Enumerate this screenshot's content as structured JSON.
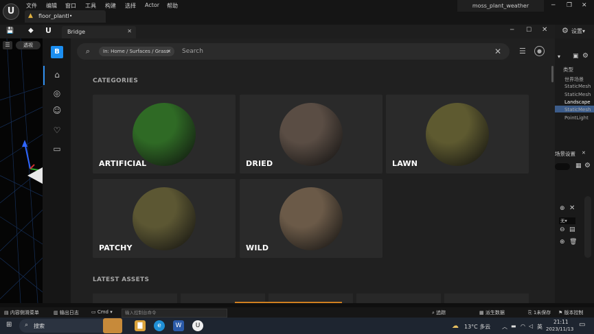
{
  "menu": [
    "文件",
    "编辑",
    "窗口",
    "工具",
    "构建",
    "选择",
    "Actor",
    "帮助"
  ],
  "level_tab": "floor_plantl•",
  "project_name": "moss_plant_weather",
  "settings_label": "设置▾",
  "viewport": {
    "view_mode": "透视"
  },
  "bridge": {
    "title": "Bridge",
    "search": {
      "placeholder": "Search",
      "scope_chip": "In: Home / Surfaces / Grass"
    },
    "categories_title": "CATEGORIES",
    "latest_assets_title": "LATEST ASSETS",
    "categories": [
      {
        "label": "ARTIFICIAL",
        "color": "#2f6a25"
      },
      {
        "label": "DRIED",
        "color": "#5a4d44"
      },
      {
        "label": "LAWN",
        "color": "#5e5a30"
      },
      {
        "label": "PATCHY",
        "color": "#5c5733"
      },
      {
        "label": "WILD",
        "color": "#6b5a48"
      }
    ]
  },
  "outliner": {
    "type_header": "类型",
    "items": [
      "世界场景",
      "StaticMesh",
      "StaticMesh",
      "Landscape",
      "StaticMesh",
      "PointLight"
    ],
    "selected_index": 3,
    "scene_settings": "场景设置",
    "dropdown_value": "无"
  },
  "status": {
    "content_drawer": "内容侧滑菜单",
    "output_log": "输出日志",
    "cmd": "Cmd",
    "console_placeholder": "输入控制台命令",
    "trace": "追踪",
    "derived_data": "派生数据",
    "unsaved": "1未保存",
    "source_control": "版本控制"
  },
  "taskbar": {
    "search": "搜索",
    "weather": "13°C 多云",
    "ime": "英",
    "time": "21:11",
    "date": "2023/11/13"
  }
}
